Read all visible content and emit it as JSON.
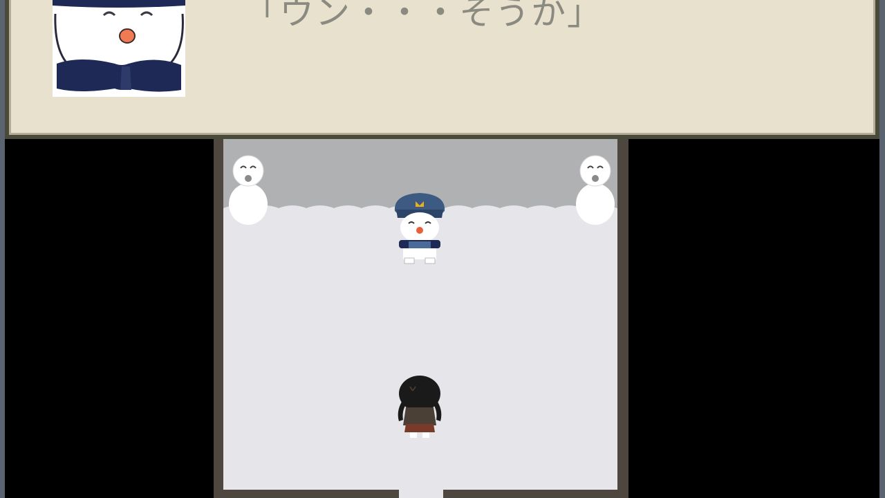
{
  "dialogue": {
    "text": "「ウン・・・そうか」",
    "speaker_portrait": "snowman-officer-portrait"
  },
  "map": {
    "scene": "snow-room",
    "characters": [
      {
        "name": "snowman-officer",
        "role": "npc"
      },
      {
        "name": "snowman-left",
        "role": "decoration"
      },
      {
        "name": "snowman-right",
        "role": "decoration"
      },
      {
        "name": "player-girl",
        "role": "player"
      }
    ]
  },
  "colors": {
    "dialogue_bg": "#e8e1cd",
    "dialogue_text": "#8a8a80",
    "floor": "#e6e5ea",
    "wall": "#b0b1b2",
    "room_border": "#4e4740",
    "hat_navy": "#1e2a55"
  }
}
